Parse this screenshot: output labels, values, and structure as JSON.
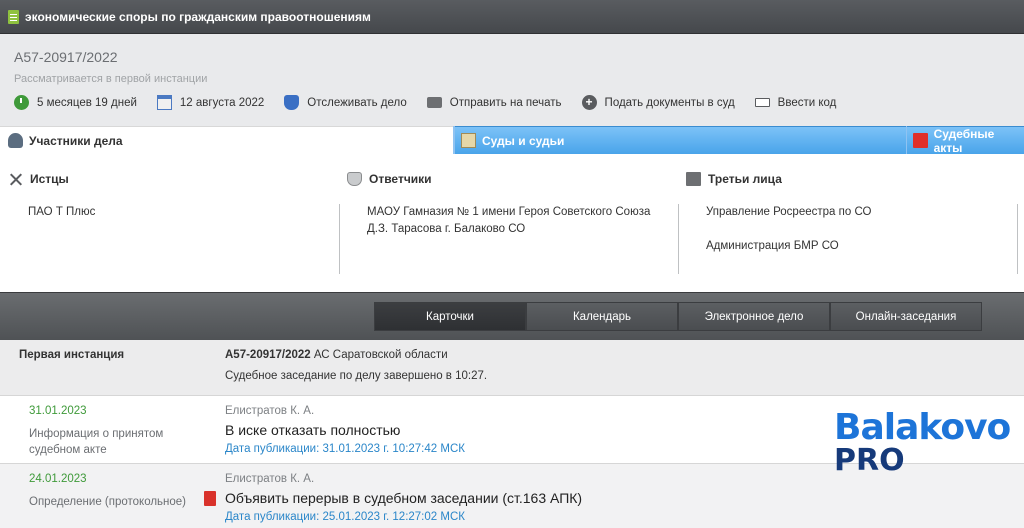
{
  "topbar": {
    "title": "экономические споры по гражданским правоотношениям"
  },
  "case": {
    "number": "А57-20917/2022",
    "status": "Рассматривается в первой инстанции"
  },
  "toolbar": {
    "duration": "5 месяцев 19 дней",
    "date": "12 августа 2022",
    "track": "Отслеживать дело",
    "print": "Отправить на печать",
    "submit": "Подать документы в суд",
    "code": "Ввести код"
  },
  "tabs": {
    "participants": "Участники дела",
    "courts": "Суды и судьи",
    "acts": "Судебные акты"
  },
  "parties": {
    "plaintiffs_title": "Истцы",
    "plaintiffs": [
      "ПАО Т Плюс"
    ],
    "defendants_title": "Ответчики",
    "defendant_line1": "МАОУ Гамназия № 1 имени Героя Советского Союза",
    "defendant_line2": "Д.З. Тарасова г. Балаково СО",
    "third_title": "Третьи лица",
    "third": [
      "Управление Росреестра по СО",
      "Администрация БМР СО"
    ]
  },
  "nav": {
    "cards": "Карточки",
    "calendar": "Календарь",
    "electronic": "Электронное дело",
    "online": "Онлайн-заседания"
  },
  "instance": {
    "label": "Первая инстанция",
    "case_number": "А57-20917/2022",
    "court": " АС Саратовской области",
    "note": "Судебное заседание по делу завершено в 10:27."
  },
  "documents": [
    {
      "date": "31.01.2023",
      "kind": "Информация о принятом судебном акте",
      "judge": "Елистратов К. А.",
      "title": "В иске отказать полностью",
      "published": "Дата публикации: 31.01.2023 г. 10:27:42 МСК"
    },
    {
      "date": "24.01.2023",
      "kind": "Определение (протокольное)",
      "judge": "Елистратов К. А.",
      "title": "Объявить перерыв в судебном заседании (ст.163 АПК)",
      "published": "Дата публикации: 25.01.2023 г. 12:27:02 МСК"
    }
  ],
  "watermark": {
    "line1": "Balakovo",
    "line2": "PRO"
  }
}
